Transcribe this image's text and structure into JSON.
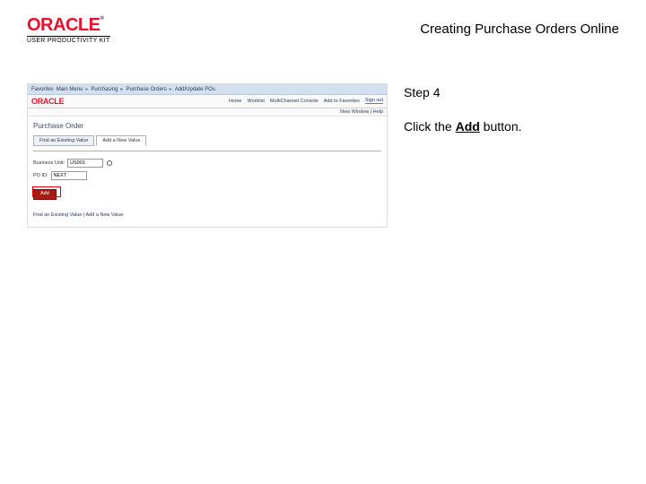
{
  "header": {
    "logo_text": "ORACLE",
    "logo_tm": "®",
    "upk_text": "USER PRODUCTIVITY KIT",
    "page_title": "Creating Purchase Orders Online"
  },
  "screenshot": {
    "breadcrumb": {
      "items": [
        "Favorites",
        "Main Menu",
        "Purchasing",
        "Purchase Orders",
        "Add/Update POs"
      ],
      "sep": "▸"
    },
    "brand": "ORACLE",
    "nav": {
      "home": "Home",
      "worklist": "Worklist",
      "multichannel": "MultiChannel Console",
      "addfav": "Add to Favorites",
      "signout": "Sign out"
    },
    "subbar": "New Window | Help",
    "form_title": "Purchase Order",
    "tabs": {
      "find": "Find an Existing Value",
      "add": "Add a New Value"
    },
    "fields": {
      "bu_label": "Business Unit:",
      "bu_value": "US001",
      "po_label": "PO ID:",
      "po_value": "NEXT"
    },
    "add_button": "Add",
    "footer_link": "Find an Existing Value | Add a New Value"
  },
  "instructions": {
    "step_label": "Step 4",
    "line_prefix": "Click the ",
    "line_bold": "Add",
    "line_suffix": " button."
  }
}
